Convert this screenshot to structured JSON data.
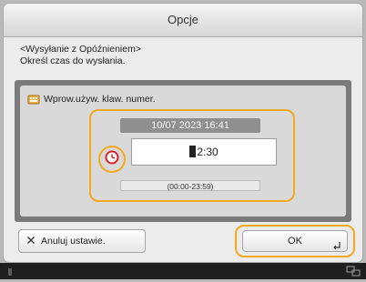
{
  "window": {
    "title": "Opcje"
  },
  "message": {
    "line1": "<Wysyłanie z Opóźnieniem>",
    "line2": "Określ czas do wysłania."
  },
  "panel": {
    "label": "Wprow.używ. klaw. numer.",
    "date_time": "10/07 2023 16:41",
    "time_value": "12:30",
    "time_value_rest": "2:30",
    "range_hint": "(00:00-23:59)"
  },
  "buttons": {
    "cancel_label": "Anuluj ustawie.",
    "ok_label": "OK"
  },
  "icons": {
    "cancel": "close-icon",
    "ok_enter": "enter-icon",
    "keyboard": "keyboard-icon",
    "clock": "clock-icon"
  },
  "colors": {
    "accent": "#f3a821",
    "clock_red": "#d9252a"
  }
}
